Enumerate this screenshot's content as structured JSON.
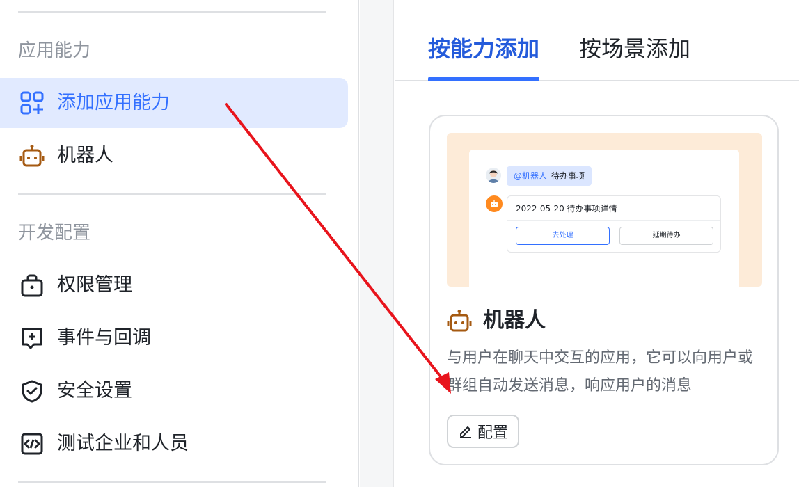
{
  "sidebar": {
    "sections": [
      {
        "title": "应用能力",
        "items": [
          {
            "label": "添加应用能力",
            "icon": "apps-add-icon",
            "active": true
          },
          {
            "label": "机器人",
            "icon": "robot-icon",
            "active": false
          }
        ]
      },
      {
        "title": "开发配置",
        "items": [
          {
            "label": "权限管理",
            "icon": "lock-bag-icon",
            "active": false
          },
          {
            "label": "事件与回调",
            "icon": "event-icon",
            "active": false
          },
          {
            "label": "安全设置",
            "icon": "shield-check-icon",
            "active": false
          },
          {
            "label": "测试企业和人员",
            "icon": "code-window-icon",
            "active": false
          }
        ]
      }
    ]
  },
  "main": {
    "tabs": [
      {
        "label": "按能力添加",
        "active": true
      },
      {
        "label": "按场景添加",
        "active": false
      }
    ],
    "card": {
      "preview": {
        "mention_at": "@机器人",
        "mention_text": "待办事项",
        "message_title": "2022-05-20 待办事项详情",
        "primary_button": "去处理",
        "secondary_button": "延期待办"
      },
      "title": "机器人",
      "icon": "robot-icon",
      "description": "与用户在聊天中交互的应用，它可以向用户或群组自动发送消息，响应用户的消息",
      "config_button": "配置"
    }
  },
  "colors": {
    "accent": "#3370ff",
    "active_bg": "#e1eaff",
    "robot_icon": "#a55a12",
    "preview_bg": "#fdebd8",
    "annotation_arrow": "#e8141c"
  }
}
